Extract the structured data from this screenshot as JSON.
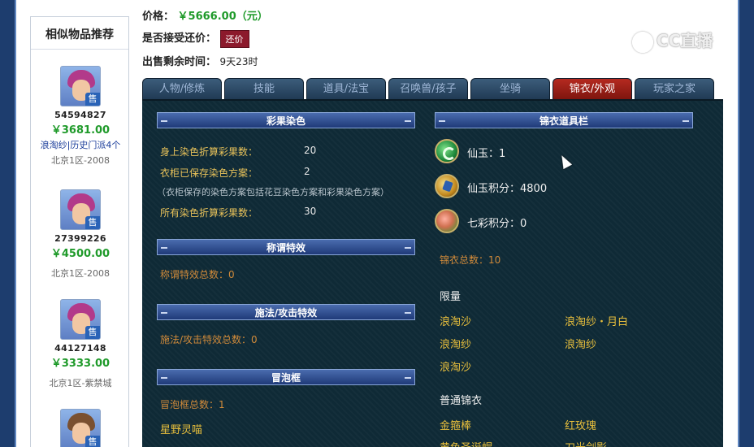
{
  "sidebar": {
    "title": "相似物品推荐",
    "items": [
      {
        "id": "54594827",
        "price": "￥3681.00",
        "name": "浪淘纱|历史门派4个",
        "server": "北京1区-2008",
        "badge": "售"
      },
      {
        "id": "27399226",
        "price": "￥4500.00",
        "name": "",
        "server": "北京1区-2008",
        "badge": "售"
      },
      {
        "id": "44127148",
        "price": "￥3333.00",
        "name": "",
        "server": "北京1区-紫禁城",
        "badge": "售"
      },
      {
        "id": "",
        "price": "",
        "name": "",
        "server": "",
        "badge": "售"
      }
    ]
  },
  "header": {
    "price_label": "价格：",
    "price_value": "￥5666.00（元）",
    "bargain_label": "是否接受还价：",
    "bargain_button": "还价",
    "time_label": "出售剩余时间：",
    "time_value": "9天23时"
  },
  "watermark": "CC直播",
  "tabs": [
    {
      "label": "人物/修炼",
      "active": false
    },
    {
      "label": "技能",
      "active": false
    },
    {
      "label": "道具/法宝",
      "active": false
    },
    {
      "label": "召唤兽/孩子",
      "active": false
    },
    {
      "label": "坐骑",
      "active": false
    },
    {
      "label": "锦衣/外观",
      "active": true
    },
    {
      "label": "玩家之家",
      "active": false
    }
  ],
  "dye": {
    "header": "彩果染色",
    "body_label": "身上染色折算彩果数：",
    "body_value": "20",
    "wardrobe_label": "衣柜已保存染色方案：",
    "wardrobe_value": "2",
    "note": "（衣柜保存的染色方案包括花豆染色方案和彩果染色方案）",
    "total_label": "所有染色折算彩果数：",
    "total_value": "30"
  },
  "title_effect": {
    "header": "称谓特效",
    "text": "称谓特效总数：0"
  },
  "cast_effect": {
    "header": "施法/攻击特效",
    "text": "施法/攻击特效总数：0"
  },
  "bubble": {
    "header": "冒泡框",
    "text": "冒泡框总数：1",
    "item": "星野灵喵"
  },
  "wardrobe": {
    "header": "锦衣道具栏",
    "jade": "仙玉：1",
    "jade_points": "仙玉积分：4800",
    "rainbow_points": "七彩积分：0",
    "total": "锦衣总数：10",
    "limited_label": "限量",
    "limited": [
      "浪淘沙",
      "浪淘纱・月白",
      "浪淘纱",
      "浪淘纱",
      "浪淘沙"
    ],
    "normal_label": "普通锦衣",
    "normal": [
      "金箍棒",
      "红玫瑰",
      "黄色圣诞帽",
      "刀光剑影"
    ]
  },
  "colors": {
    "accent_green": "#1f9a2a",
    "tab_active": "#9b1f16",
    "panel_bg": "#0f2a36",
    "label_yellow": "#e9c35a"
  }
}
